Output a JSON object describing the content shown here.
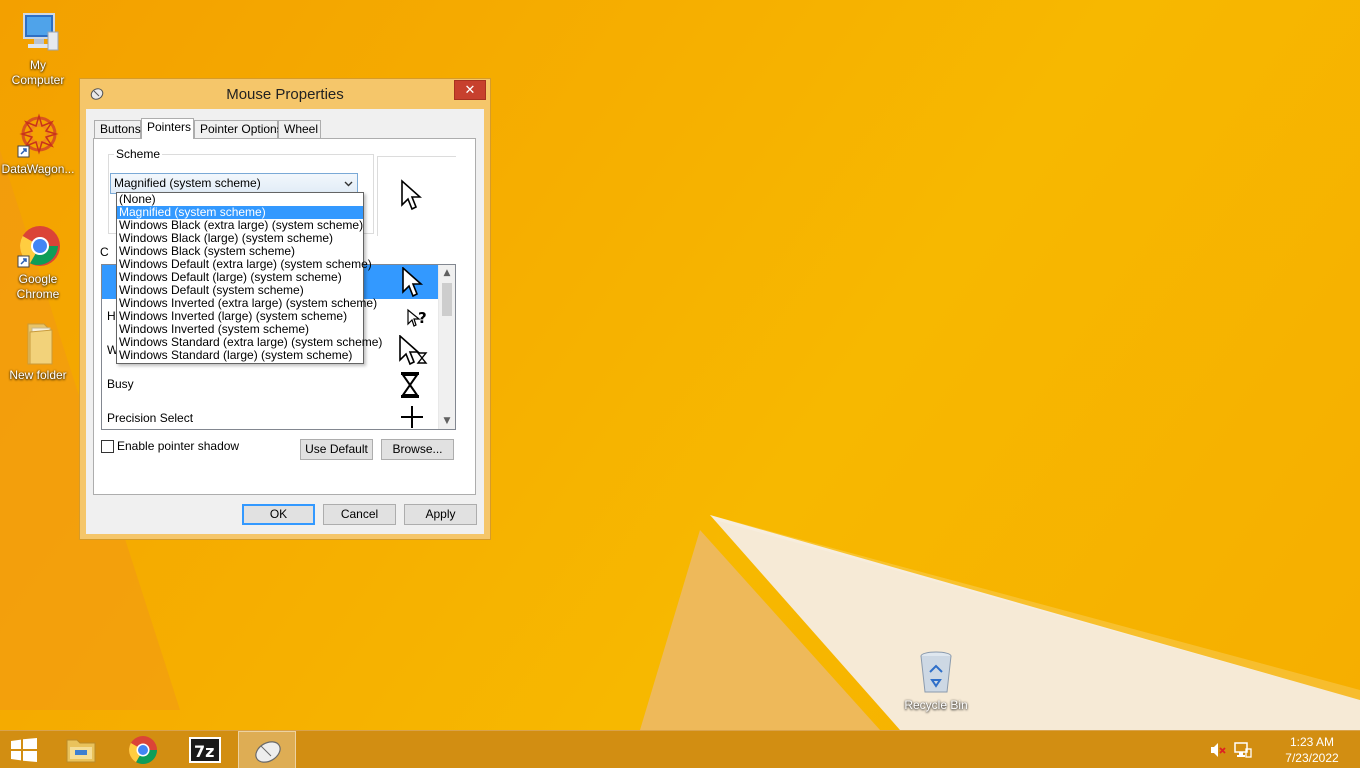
{
  "desktop": {
    "icons": [
      {
        "label": "My\nComputer"
      },
      {
        "label": "DataWagon..."
      },
      {
        "label": "Google\nChrome"
      },
      {
        "label": "New folder"
      },
      {
        "label": "Recycle Bin"
      }
    ]
  },
  "window": {
    "title": "Mouse Properties",
    "close_glyph": "✕",
    "tabs": [
      {
        "label": "Buttons"
      },
      {
        "label": "Pointers"
      },
      {
        "label": "Pointer Options"
      },
      {
        "label": "Wheel"
      }
    ],
    "active_tab": "Pointers",
    "scheme": {
      "group_label": "Scheme",
      "selected": "Magnified (system scheme)",
      "options": [
        "(None)",
        "Magnified (system scheme)",
        "Windows Black (extra large) (system scheme)",
        "Windows Black (large) (system scheme)",
        "Windows Black (system scheme)",
        "Windows Default (extra large) (system scheme)",
        "Windows Default (large) (system scheme)",
        "Windows Default (system scheme)",
        "Windows Inverted (extra large) (system scheme)",
        "Windows Inverted (large) (system scheme)",
        "Windows Inverted (system scheme)",
        "Windows Standard (extra large) (system scheme)",
        "Windows Standard (large) (system scheme)"
      ],
      "highlighted_index": 1
    },
    "customize_label_fragment": "C",
    "pointer_list": [
      {
        "label": "",
        "cursor": "arrow-cursor-icon",
        "selected": true
      },
      {
        "label": "H",
        "cursor": "help-cursor-icon",
        "selected": false
      },
      {
        "label": "W",
        "cursor": "working-cursor-icon",
        "selected": false
      },
      {
        "label": "Busy",
        "cursor": "hourglass-cursor-icon",
        "selected": false
      },
      {
        "label": "Precision Select",
        "cursor": "crosshair-cursor-icon",
        "selected": false
      }
    ],
    "enable_shadow_label": "Enable pointer shadow",
    "use_default_label": "Use Default",
    "browse_label": "Browse...",
    "ok_label": "OK",
    "cancel_label": "Cancel",
    "apply_label": "Apply"
  },
  "taskbar": {
    "time": "1:23 AM",
    "date": "7/23/2022",
    "items": [
      "start-icon",
      "file-explorer-icon",
      "chrome-icon",
      "7zip-icon",
      "mouse-icon"
    ]
  },
  "colors": {
    "accent": "#3399ff",
    "desktop": "#f6b000",
    "titlebar": "#f5c66a",
    "close": "#c7402e"
  }
}
